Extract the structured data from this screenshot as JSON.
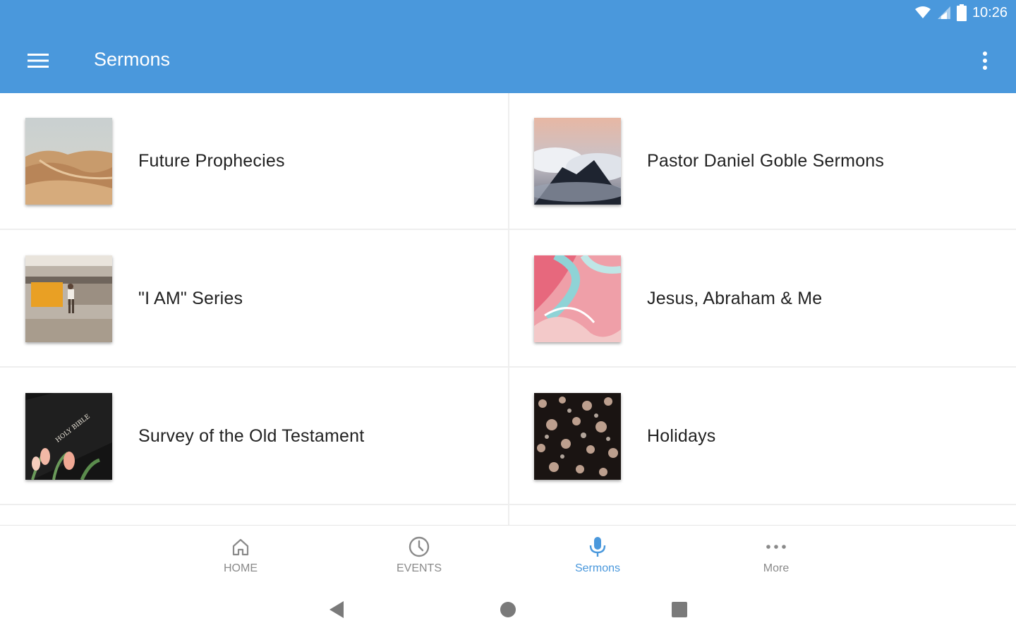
{
  "status": {
    "time": "10:26"
  },
  "toolbar": {
    "title": "Sermons"
  },
  "series": [
    {
      "label": "Future Prophecies",
      "thumb": "desert-dunes-image"
    },
    {
      "label": "Pastor Daniel Goble Sermons",
      "thumb": "clouds-mountain-image"
    },
    {
      "label": "\"I AM\" Series",
      "thumb": "train-platform-image"
    },
    {
      "label": "Jesus, Abraham & Me",
      "thumb": "pink-marble-image"
    },
    {
      "label": "Survey of the Old Testament",
      "thumb": "holy-bible-tulips-image",
      "thumb_text": "HOLY BIBLE"
    },
    {
      "label": "Holidays",
      "thumb": "bokeh-lights-image"
    }
  ],
  "bottom_nav": [
    {
      "label": "HOME",
      "icon": "home-icon",
      "active": false
    },
    {
      "label": "EVENTS",
      "icon": "clock-icon",
      "active": false
    },
    {
      "label": "Sermons",
      "icon": "microphone-icon",
      "active": true
    },
    {
      "label": "More",
      "icon": "more-horizontal-icon",
      "active": false
    }
  ],
  "colors": {
    "primary": "#4a98dc",
    "inactive_nav": "#8a8a8a",
    "text": "#222222"
  }
}
